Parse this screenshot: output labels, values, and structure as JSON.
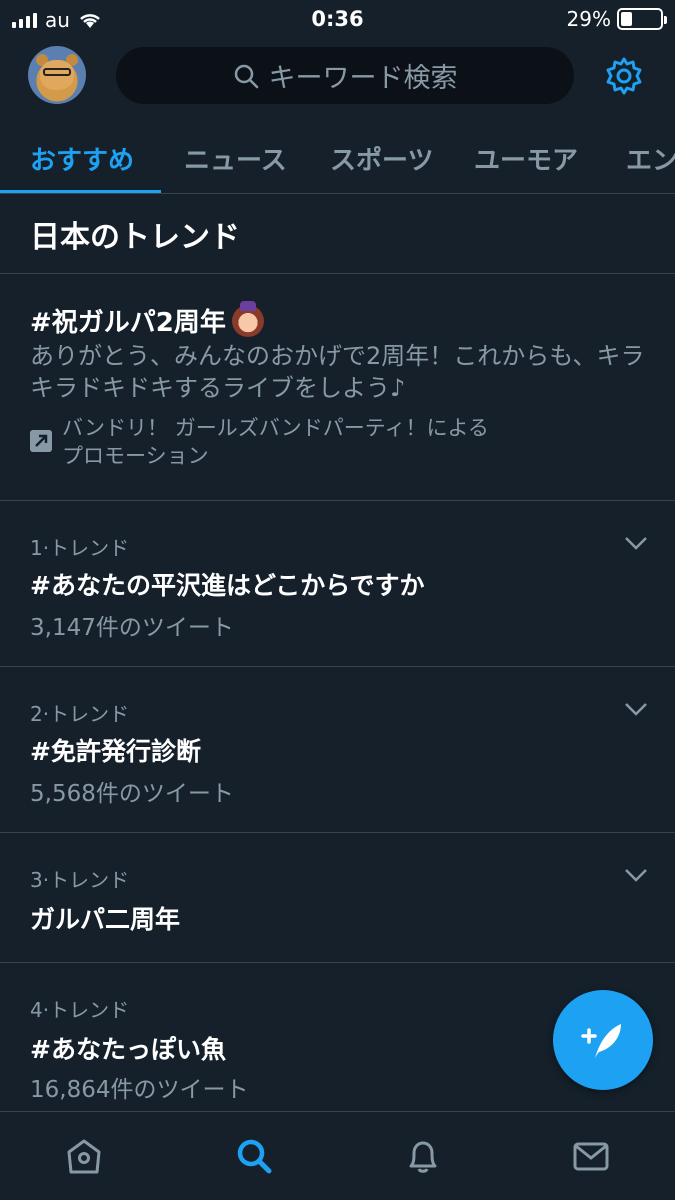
{
  "status_bar": {
    "carrier": "au",
    "time": "0:36",
    "battery_percent": "29%",
    "battery_level": 0.29,
    "signal_bars": 4
  },
  "header": {
    "search_placeholder": "キーワード検索",
    "icons": [
      "avatar",
      "search-icon",
      "gear-icon"
    ]
  },
  "tabs": [
    {
      "label": "おすすめ",
      "active": true
    },
    {
      "label": "ニュース",
      "active": false
    },
    {
      "label": "スポーツ",
      "active": false
    },
    {
      "label": "ユーモア",
      "active": false
    },
    {
      "label": "エン",
      "active": false
    }
  ],
  "section_title": "日本のトレンド",
  "promoted": {
    "title": "#祝ガルパ2周年",
    "description": "ありがとう、みんなのおかげで2周年！これからも、キラキラドキドキするライブをしよう♪",
    "by_line1": "バンドリ！ ガールズバンドパーティ！による",
    "by_line2": "プロモーション"
  },
  "trends": [
    {
      "meta": "1·トレンド",
      "name": "#あなたの平沢進はどこからですか",
      "count": "3,147件のツイート"
    },
    {
      "meta": "2·トレンド",
      "name": "#免許発行診断",
      "count": "5,568件のツイート"
    },
    {
      "meta": "3·トレンド",
      "name": "ガルパ二周年",
      "count": ""
    },
    {
      "meta": "4·トレンド",
      "name": "#あなたっぽい魚",
      "count": "16,864件のツイート"
    }
  ],
  "bottom_nav": [
    "home-icon",
    "search-icon",
    "notifications-icon",
    "messages-icon"
  ],
  "colors": {
    "background": "#15202b",
    "accent": "#1da1f2",
    "secondary_text": "#8899a6",
    "divider": "#38444d"
  }
}
